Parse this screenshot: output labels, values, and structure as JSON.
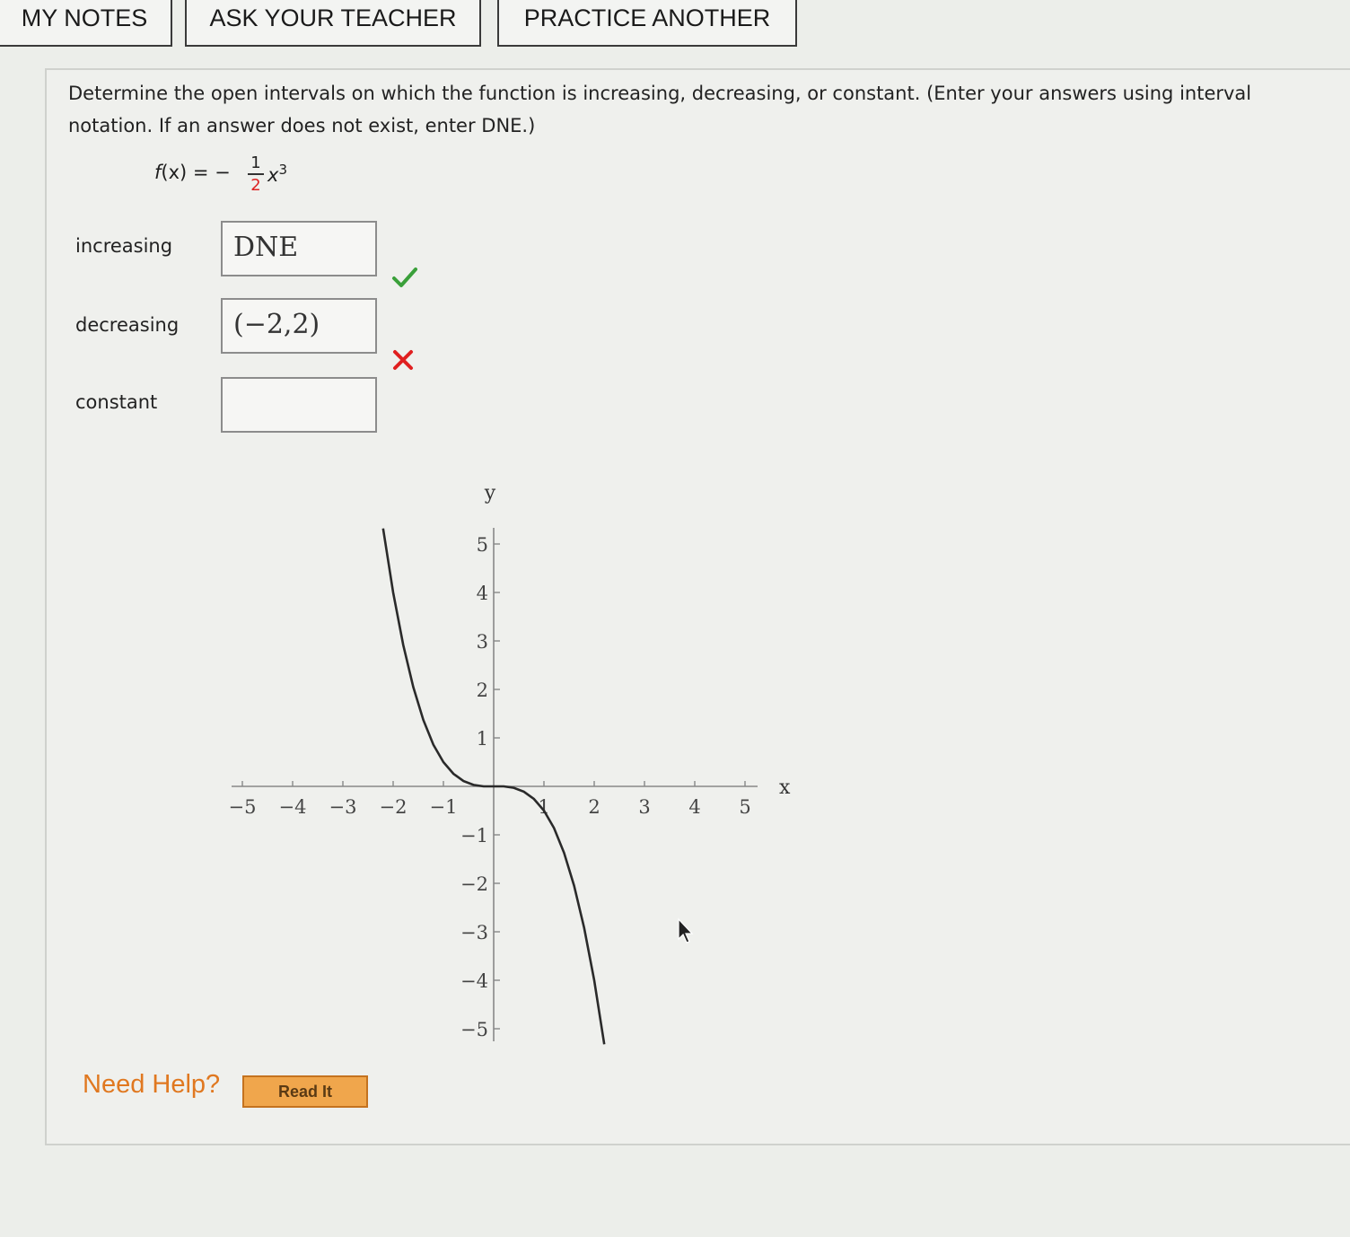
{
  "tabs": [
    {
      "label": "MY NOTES"
    },
    {
      "label": "ASK YOUR TEACHER"
    },
    {
      "label": "PRACTICE ANOTHER"
    }
  ],
  "question": {
    "text": "Determine the open intervals on which the function is increasing, decreasing, or constant. (Enter your answers using interval notation. If an answer does not exist, enter DNE.)"
  },
  "formula": {
    "lhs": "f",
    "arg": "(x) = −",
    "numerator": "1",
    "denominator": "2",
    "variable": "x",
    "exponent": "3"
  },
  "answers": [
    {
      "label": "increasing",
      "value": "DNE",
      "status": "correct"
    },
    {
      "label": "decreasing",
      "value": "(−2,2)",
      "status": "incorrect"
    },
    {
      "label": "constant",
      "value": "",
      "status": "none"
    }
  ],
  "status_colors": {
    "correct": "#3aa03a",
    "incorrect": "#e02020"
  },
  "chart_data": {
    "type": "line",
    "function": "f(x) = -(1/2)x^3",
    "xlabel": "x",
    "ylabel": "y",
    "xlim": [
      -5,
      5
    ],
    "ylim": [
      -5,
      5
    ],
    "x_ticks": [
      "−5",
      "−4",
      "−3",
      "−2",
      "−1",
      "1",
      "2",
      "3",
      "4",
      "5"
    ],
    "y_ticks": [
      "5",
      "4",
      "3",
      "2",
      "1",
      "−1",
      "−2",
      "−3",
      "−4",
      "−5"
    ],
    "series": [
      {
        "x": [
          -2.2,
          -2.0,
          -1.8,
          -1.6,
          -1.4,
          -1.2,
          -1.0,
          -0.8,
          -0.6,
          -0.4,
          -0.2,
          0.0,
          0.2,
          0.4,
          0.6,
          0.8,
          1.0,
          1.2,
          1.4,
          1.6,
          1.8,
          2.0,
          2.2
        ],
        "y": [
          5.32,
          4.0,
          2.92,
          2.05,
          1.37,
          0.86,
          0.5,
          0.26,
          0.11,
          0.03,
          0.0,
          0.0,
          0.0,
          -0.03,
          -0.11,
          -0.26,
          -0.5,
          -0.86,
          -1.37,
          -2.05,
          -2.92,
          -4.0,
          -5.32
        ]
      }
    ]
  },
  "help": {
    "label": "Need Help?",
    "button": "Read It"
  }
}
